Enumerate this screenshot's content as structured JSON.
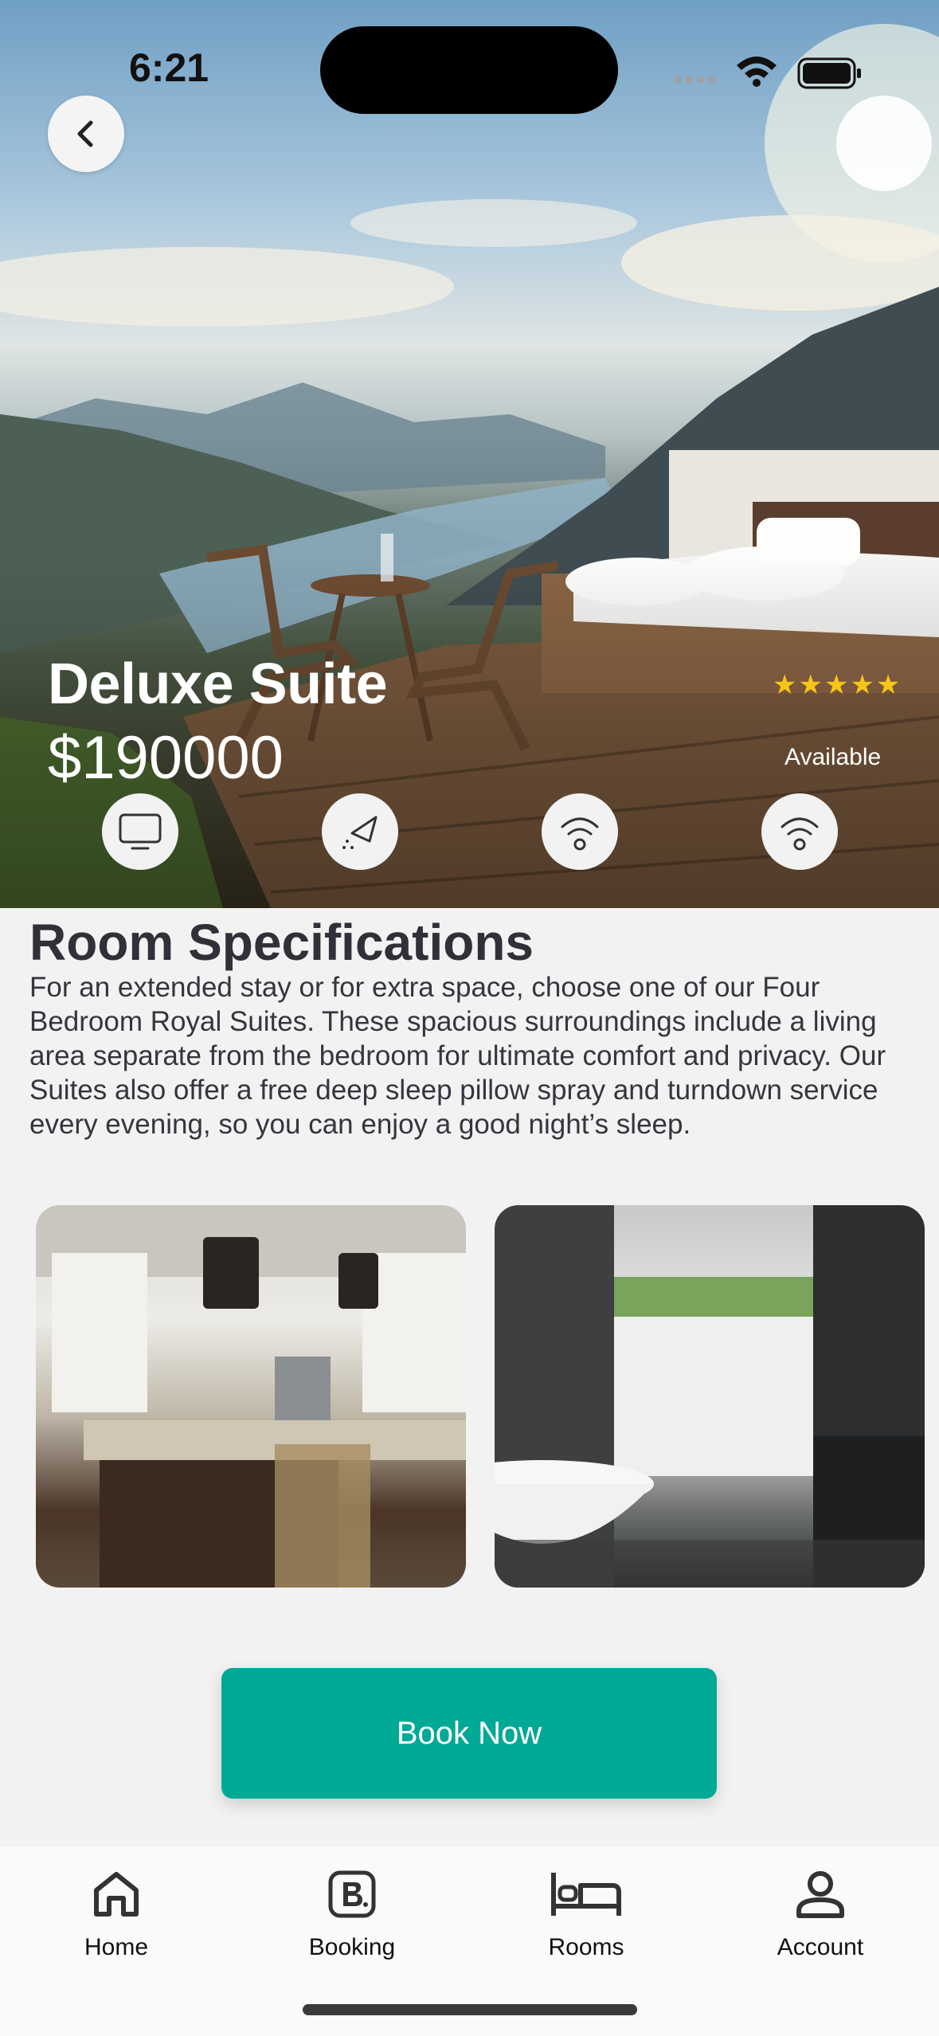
{
  "status_bar": {
    "time": "6:21"
  },
  "room": {
    "name": "Deluxe Suite",
    "price": "$190000",
    "rating_stars": "★★★★★",
    "rating": 5,
    "availability": "Available"
  },
  "amenities": [
    {
      "icon": "tv-icon"
    },
    {
      "icon": "cleaning-icon"
    },
    {
      "icon": "wifi-icon"
    },
    {
      "icon": "wifi-icon"
    }
  ],
  "specifications": {
    "title": "Room Specifications",
    "description": "For an extended stay or for extra space, choose one of our Four Bedroom Royal Suites. These spacious surroundings include a living area separate from the bedroom for ultimate comfort and privacy. Our Suites also offer a free deep sleep pillow spray and turndown service every evening, so you can enjoy a good night’s sleep."
  },
  "gallery": [
    {
      "name": "kitchen-photo"
    },
    {
      "name": "bathroom-photo"
    }
  ],
  "actions": {
    "book_label": "Book Now"
  },
  "colors": {
    "accent": "#00a896",
    "star": "#f5c518",
    "background": "#f2f2f2"
  },
  "tabbar": {
    "items": [
      {
        "label": "Home",
        "icon": "home-icon"
      },
      {
        "label": "Booking",
        "icon": "booking-icon"
      },
      {
        "label": "Rooms",
        "icon": "bed-icon"
      },
      {
        "label": "Account",
        "icon": "account-icon"
      }
    ]
  }
}
